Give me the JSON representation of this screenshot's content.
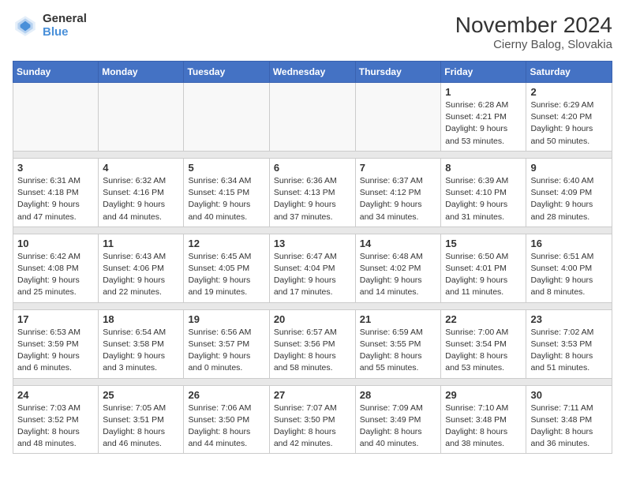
{
  "header": {
    "logo_general": "General",
    "logo_blue": "Blue",
    "title": "November 2024",
    "subtitle": "Cierny Balog, Slovakia"
  },
  "weekdays": [
    "Sunday",
    "Monday",
    "Tuesday",
    "Wednesday",
    "Thursday",
    "Friday",
    "Saturday"
  ],
  "weeks": [
    [
      {
        "day": "",
        "info": ""
      },
      {
        "day": "",
        "info": ""
      },
      {
        "day": "",
        "info": ""
      },
      {
        "day": "",
        "info": ""
      },
      {
        "day": "",
        "info": ""
      },
      {
        "day": "1",
        "info": "Sunrise: 6:28 AM\nSunset: 4:21 PM\nDaylight: 9 hours and 53 minutes."
      },
      {
        "day": "2",
        "info": "Sunrise: 6:29 AM\nSunset: 4:20 PM\nDaylight: 9 hours and 50 minutes."
      }
    ],
    [
      {
        "day": "3",
        "info": "Sunrise: 6:31 AM\nSunset: 4:18 PM\nDaylight: 9 hours and 47 minutes."
      },
      {
        "day": "4",
        "info": "Sunrise: 6:32 AM\nSunset: 4:16 PM\nDaylight: 9 hours and 44 minutes."
      },
      {
        "day": "5",
        "info": "Sunrise: 6:34 AM\nSunset: 4:15 PM\nDaylight: 9 hours and 40 minutes."
      },
      {
        "day": "6",
        "info": "Sunrise: 6:36 AM\nSunset: 4:13 PM\nDaylight: 9 hours and 37 minutes."
      },
      {
        "day": "7",
        "info": "Sunrise: 6:37 AM\nSunset: 4:12 PM\nDaylight: 9 hours and 34 minutes."
      },
      {
        "day": "8",
        "info": "Sunrise: 6:39 AM\nSunset: 4:10 PM\nDaylight: 9 hours and 31 minutes."
      },
      {
        "day": "9",
        "info": "Sunrise: 6:40 AM\nSunset: 4:09 PM\nDaylight: 9 hours and 28 minutes."
      }
    ],
    [
      {
        "day": "10",
        "info": "Sunrise: 6:42 AM\nSunset: 4:08 PM\nDaylight: 9 hours and 25 minutes."
      },
      {
        "day": "11",
        "info": "Sunrise: 6:43 AM\nSunset: 4:06 PM\nDaylight: 9 hours and 22 minutes."
      },
      {
        "day": "12",
        "info": "Sunrise: 6:45 AM\nSunset: 4:05 PM\nDaylight: 9 hours and 19 minutes."
      },
      {
        "day": "13",
        "info": "Sunrise: 6:47 AM\nSunset: 4:04 PM\nDaylight: 9 hours and 17 minutes."
      },
      {
        "day": "14",
        "info": "Sunrise: 6:48 AM\nSunset: 4:02 PM\nDaylight: 9 hours and 14 minutes."
      },
      {
        "day": "15",
        "info": "Sunrise: 6:50 AM\nSunset: 4:01 PM\nDaylight: 9 hours and 11 minutes."
      },
      {
        "day": "16",
        "info": "Sunrise: 6:51 AM\nSunset: 4:00 PM\nDaylight: 9 hours and 8 minutes."
      }
    ],
    [
      {
        "day": "17",
        "info": "Sunrise: 6:53 AM\nSunset: 3:59 PM\nDaylight: 9 hours and 6 minutes."
      },
      {
        "day": "18",
        "info": "Sunrise: 6:54 AM\nSunset: 3:58 PM\nDaylight: 9 hours and 3 minutes."
      },
      {
        "day": "19",
        "info": "Sunrise: 6:56 AM\nSunset: 3:57 PM\nDaylight: 9 hours and 0 minutes."
      },
      {
        "day": "20",
        "info": "Sunrise: 6:57 AM\nSunset: 3:56 PM\nDaylight: 8 hours and 58 minutes."
      },
      {
        "day": "21",
        "info": "Sunrise: 6:59 AM\nSunset: 3:55 PM\nDaylight: 8 hours and 55 minutes."
      },
      {
        "day": "22",
        "info": "Sunrise: 7:00 AM\nSunset: 3:54 PM\nDaylight: 8 hours and 53 minutes."
      },
      {
        "day": "23",
        "info": "Sunrise: 7:02 AM\nSunset: 3:53 PM\nDaylight: 8 hours and 51 minutes."
      }
    ],
    [
      {
        "day": "24",
        "info": "Sunrise: 7:03 AM\nSunset: 3:52 PM\nDaylight: 8 hours and 48 minutes."
      },
      {
        "day": "25",
        "info": "Sunrise: 7:05 AM\nSunset: 3:51 PM\nDaylight: 8 hours and 46 minutes."
      },
      {
        "day": "26",
        "info": "Sunrise: 7:06 AM\nSunset: 3:50 PM\nDaylight: 8 hours and 44 minutes."
      },
      {
        "day": "27",
        "info": "Sunrise: 7:07 AM\nSunset: 3:50 PM\nDaylight: 8 hours and 42 minutes."
      },
      {
        "day": "28",
        "info": "Sunrise: 7:09 AM\nSunset: 3:49 PM\nDaylight: 8 hours and 40 minutes."
      },
      {
        "day": "29",
        "info": "Sunrise: 7:10 AM\nSunset: 3:48 PM\nDaylight: 8 hours and 38 minutes."
      },
      {
        "day": "30",
        "info": "Sunrise: 7:11 AM\nSunset: 3:48 PM\nDaylight: 8 hours and 36 minutes."
      }
    ]
  ]
}
